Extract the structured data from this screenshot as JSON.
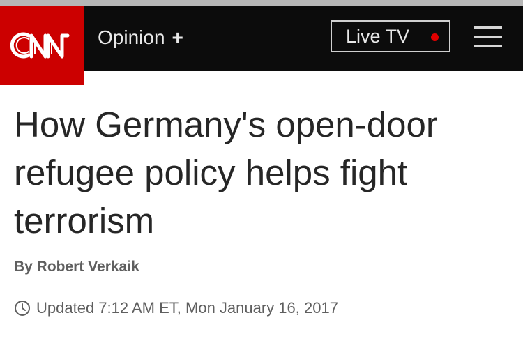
{
  "header": {
    "logo_text": "CNN",
    "section_label": "Opinion",
    "section_expand_symbol": "+",
    "live_tv_label": "Live TV",
    "menu_icon": "hamburger-menu-icon"
  },
  "article": {
    "headline": "How Germany's open-door refugee policy helps fight terrorism",
    "byline": "By Robert Verkaik",
    "timestamp": "Updated 7:12 AM ET, Mon January 16, 2017",
    "timestamp_icon": "clock-icon"
  },
  "colors": {
    "brand_red": "#cc0000",
    "navbar_bg": "#0c0c0c",
    "live_dot": "#e00000",
    "headline_text": "#262626",
    "meta_text": "#5f5f5f"
  }
}
